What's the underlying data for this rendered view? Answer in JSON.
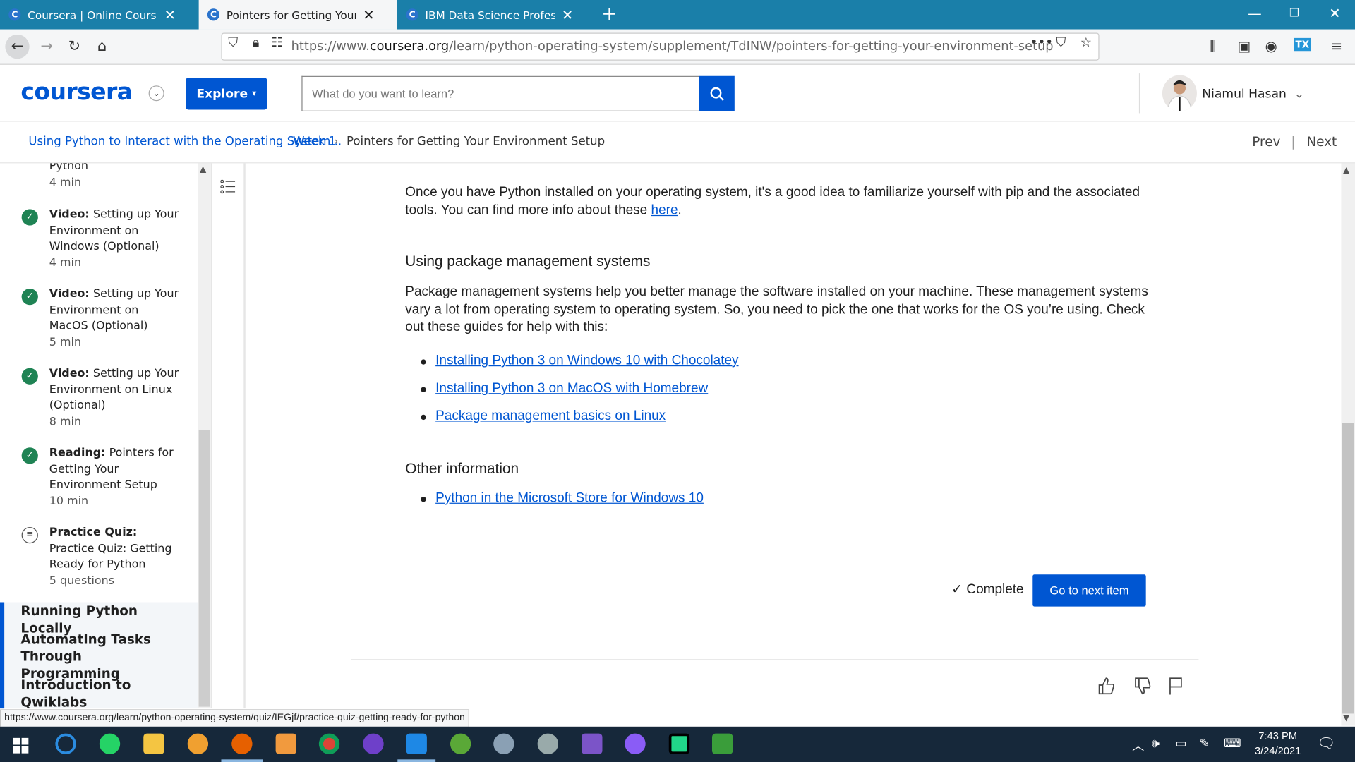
{
  "browser": {
    "tabs": [
      {
        "title": "Coursera | Online Courses & Cre",
        "active": false
      },
      {
        "title": "Pointers for Getting Your Enviro",
        "active": true
      },
      {
        "title": "IBM Data Science Professional C",
        "active": false
      }
    ],
    "url_prefix": "https://www.",
    "url_domain": "coursera.org",
    "url_path": "/learn/python-operating-system/supplement/TdINW/pointers-for-getting-your-environment-setup",
    "status_url": "https://www.coursera.org/learn/python-operating-system/quiz/IEGjf/practice-quiz-getting-ready-for-python"
  },
  "header": {
    "logo": "coursera",
    "explore_label": "Explore",
    "search_placeholder": "What do you want to learn?",
    "user_name": "Niamul Hasan"
  },
  "breadcrumb": {
    "course": "Using Python to Interact with the Operating System...",
    "week": "Week 1",
    "current": "Pointers for Getting Your Environment Setup",
    "prev": "Prev",
    "next": "Next"
  },
  "sidebar": {
    "items": [
      {
        "title_rest": "Python",
        "duration": "4 min"
      },
      {
        "kind": "Video:",
        "title_rest": "Setting up Your Environment on Windows (Optional)",
        "duration": "4 min",
        "completed": true
      },
      {
        "kind": "Video:",
        "title_rest": "Setting up Your Environment on MacOS (Optional)",
        "duration": "5 min",
        "completed": true
      },
      {
        "kind": "Video:",
        "title_rest": "Setting up Your Environment on Linux (Optional)",
        "duration": "8 min",
        "completed": true
      },
      {
        "kind": "Reading:",
        "title_rest": "Pointers for Getting Your Environment Setup",
        "duration": "10 min",
        "completed": true,
        "selected": true
      },
      {
        "kind": "Practice Quiz:",
        "title_rest": "Practice Quiz: Getting Ready for Python",
        "duration": "5 questions",
        "completed": false
      }
    ],
    "modules": [
      "Running Python Locally",
      "Automating Tasks Through Programming",
      "Introduction to Qwiklabs"
    ]
  },
  "content": {
    "intro": " Once you have Python installed on your operating system, it's a good idea to familiarize yourself with pip and the associated tools. You can find more info about these ",
    "intro_link": "here",
    "intro_end": ".",
    "heading1": "Using package management systems",
    "para1": "Package management systems help you better manage the software installed on your machine. These management systems vary a lot from operating system to operating system. So, you need to pick the one that works for the OS you’re using. Check out these guides for help with this:",
    "links1": [
      "Installing Python 3 on Windows 10 with Chocolatey",
      "Installing Python 3 on MacOS with Homebrew",
      "Package management basics on Linux"
    ],
    "heading2": "Other information",
    "links2": [
      "Python in the Microsoft Store for Windows 10"
    ],
    "complete_label": "Complete",
    "next_item_label": "Go to next item"
  },
  "taskbar": {
    "time": "7:43 PM",
    "date": "3/24/2021"
  },
  "colors": {
    "brand": "#0056d2",
    "tabbar": "#1a7fa9",
    "complete_green": "#1f8354",
    "taskbar": "#16283a"
  }
}
